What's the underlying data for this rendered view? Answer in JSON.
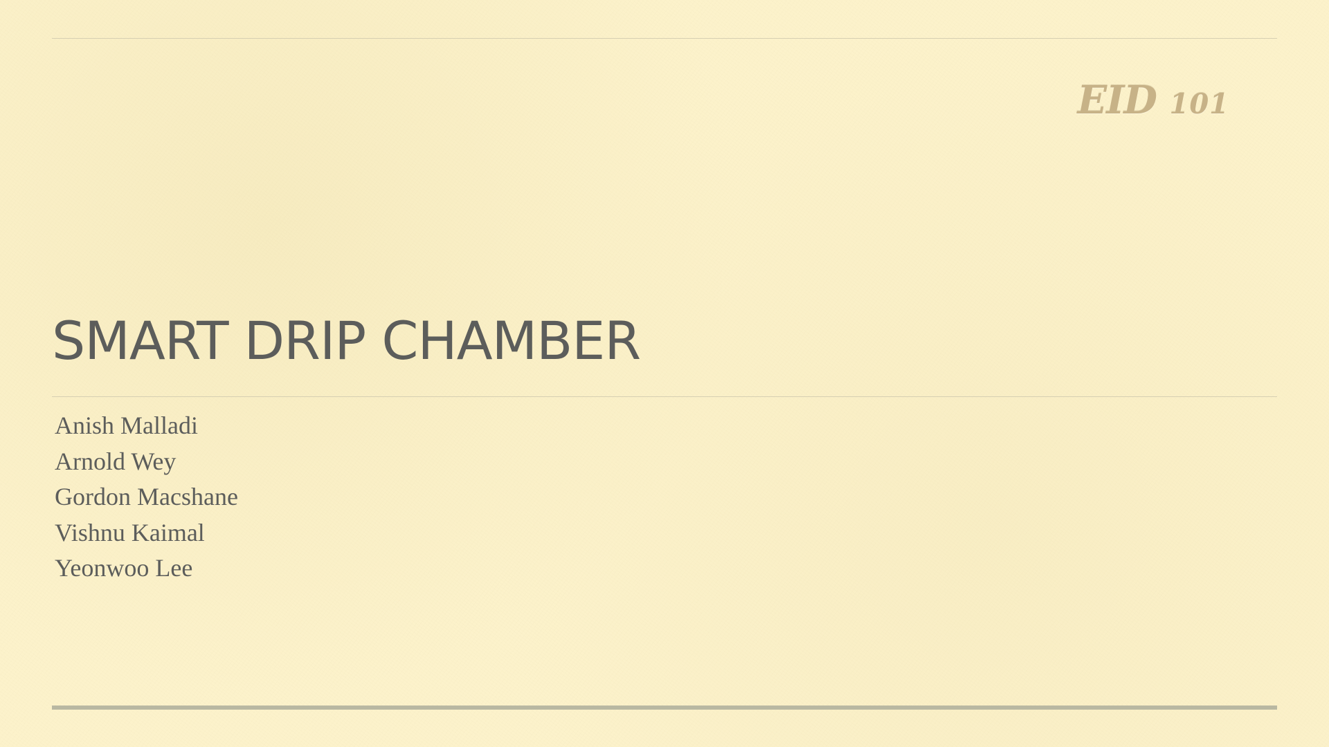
{
  "brand": {
    "prefix": "EID",
    "number": "101"
  },
  "slide": {
    "title": "SMART DRIP CHAMBER",
    "authors": [
      "Anish Malladi",
      "Arnold Wey",
      "Gordon Macshane",
      "Vishnu Kaimal",
      "Yeonwoo Lee"
    ]
  }
}
